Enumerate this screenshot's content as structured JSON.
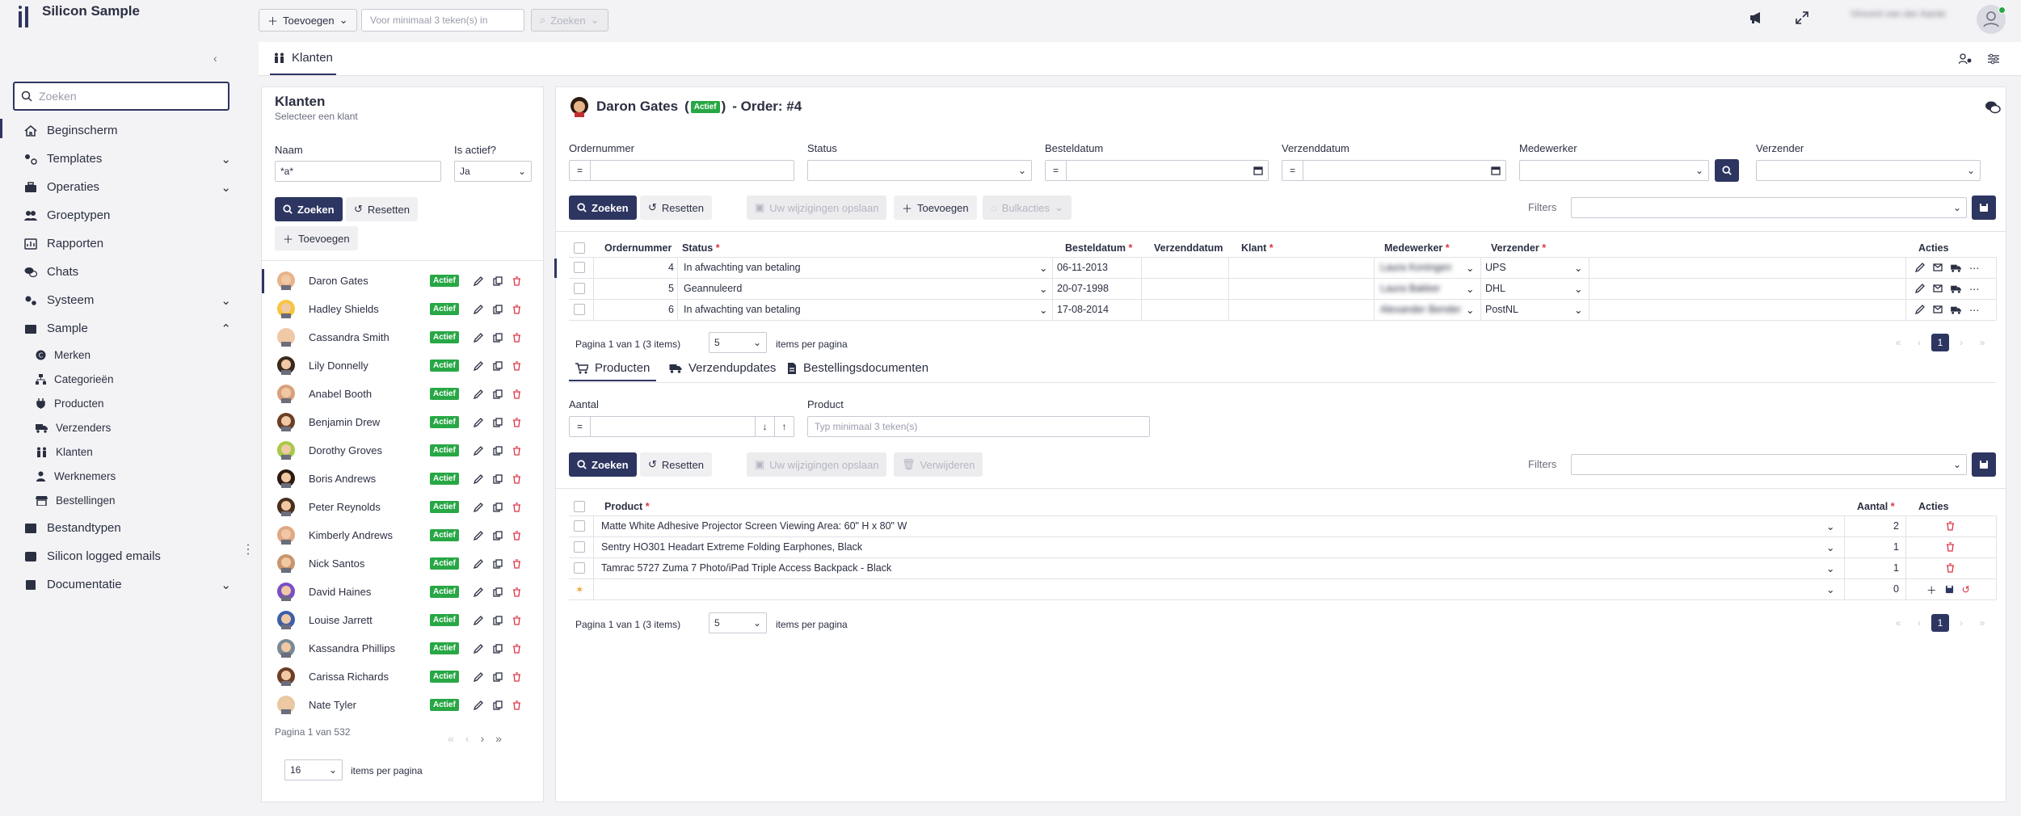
{
  "app": {
    "title": "Silicon Sample"
  },
  "topbar": {
    "add_label": "Toevoegen",
    "search_placeholder": "Voor minimaal 3 teken(s) in",
    "search_button": "Zoeken",
    "user_name": "Vincent van der Aarde"
  },
  "sidebar": {
    "search_placeholder": "Zoeken",
    "items": [
      {
        "label": "Beginscherm",
        "icon": "home-icon"
      },
      {
        "label": "Templates",
        "icon": "templates-icon"
      },
      {
        "label": "Operaties",
        "icon": "briefcase-icon"
      },
      {
        "label": "Groeptypen",
        "icon": "users-icon"
      },
      {
        "label": "Rapporten",
        "icon": "report-icon"
      },
      {
        "label": "Chats",
        "icon": "chat-icon"
      },
      {
        "label": "Systeem",
        "icon": "gears-icon"
      },
      {
        "label": "Sample",
        "icon": "database-icon"
      }
    ],
    "sub_items": [
      {
        "label": "Merken",
        "icon": "copyright-icon"
      },
      {
        "label": "Categorieën",
        "icon": "sitemap-icon"
      },
      {
        "label": "Producten",
        "icon": "plug-icon"
      },
      {
        "label": "Verzenders",
        "icon": "truck-icon"
      },
      {
        "label": "Klanten",
        "icon": "people-icon"
      },
      {
        "label": "Werknemers",
        "icon": "user-icon"
      },
      {
        "label": "Bestellingen",
        "icon": "store-icon"
      }
    ],
    "bottom_items": [
      {
        "label": "Bestandtypen",
        "icon": "filetype-icon"
      },
      {
        "label": "Silicon logged emails",
        "icon": "email-log-icon"
      },
      {
        "label": "Documentatie",
        "icon": "book-icon"
      }
    ]
  },
  "tabbar": {
    "tab_label": "Klanten"
  },
  "customers": {
    "title": "Klanten",
    "subtitle": "Selecteer een klant",
    "name_label": "Naam",
    "name_value": "*a*",
    "active_label": "Is actief?",
    "active_value": "Ja",
    "search_btn": "Zoeken",
    "reset_btn": "Resetten",
    "add_btn": "Toevoegen",
    "badge": "Actief",
    "list": [
      "Daron Gates",
      "Hadley Shields",
      "Cassandra Smith",
      "Lily Donnelly",
      "Anabel Booth",
      "Benjamin Drew",
      "Dorothy Groves",
      "Boris Andrews",
      "Peter Reynolds",
      "Kimberly Andrews",
      "Nick Santos",
      "David Haines",
      "Louise Jarrett",
      "Kassandra Phillips",
      "Carissa Richards",
      "Nate Tyler"
    ],
    "avatar_colors": [
      "#e8b48a",
      "#f5c542",
      "#f0c8a8",
      "#3a2a1e",
      "#d9a07c",
      "#6b3f26",
      "#a8c94a",
      "#2b1a10",
      "#4a2e1e",
      "#e0a884",
      "#c8956d",
      "#7a4fc4",
      "#3d5fa8",
      "#7a8a94",
      "#6b3f26",
      "#e8c8a0"
    ],
    "page_text": "Pagina 1 van 532",
    "per_page": "16",
    "per_page_label": "items per pagina"
  },
  "order": {
    "customer": "Daron Gates",
    "badge": "Actief",
    "title_suffix": "- Order: #4",
    "paren_open": "(",
    "paren_close": ")",
    "filters": {
      "ordernummer": "Ordernummer",
      "status": "Status",
      "besteldatum": "Besteldatum",
      "verzenddatum": "Verzenddatum",
      "medewerker": "Medewerker",
      "verzender": "Verzender",
      "eq": "="
    },
    "buttons": {
      "search": "Zoeken",
      "reset": "Resetten",
      "save": "Uw wijzigingen opslaan",
      "add": "Toevoegen",
      "bulk": "Bulkacties",
      "filters": "Filters"
    },
    "columns": [
      "Ordernummer",
      "Status",
      "Besteldatum",
      "Verzenddatum",
      "Klant",
      "Medewerker",
      "Verzender",
      "Acties"
    ],
    "required_mark": "*",
    "rows": [
      {
        "nr": "4",
        "status": "In afwachting van betaling",
        "date": "06-11-2013",
        "ship": "",
        "klant": "",
        "emp": "Laura Koningen",
        "carrier": "UPS"
      },
      {
        "nr": "5",
        "status": "Geannuleerd",
        "date": "20-07-1998",
        "ship": "",
        "klant": "",
        "emp": "Laura Bakker",
        "carrier": "DHL"
      },
      {
        "nr": "6",
        "status": "In afwachting van betaling",
        "date": "17-08-2014",
        "ship": "",
        "klant": "",
        "emp": "Alexander Bender",
        "carrier": "PostNL"
      }
    ],
    "page_text": "Pagina 1 van 1 (3 items)",
    "per_page": "5",
    "per_page_label": "items per pagina",
    "current_page": "1"
  },
  "subtabs": [
    {
      "label": "Producten",
      "icon": "cart-icon"
    },
    {
      "label": "Verzendupdates",
      "icon": "truck-icon"
    },
    {
      "label": "Bestellingsdocumenten",
      "icon": "document-icon"
    }
  ],
  "products": {
    "aantal_label": "Aantal",
    "product_label": "Product",
    "product_placeholder": "Typ minimaal 3 teken(s)",
    "eq": "=",
    "buttons": {
      "search": "Zoeken",
      "reset": "Resetten",
      "save": "Uw wijzigingen opslaan",
      "delete": "Verwijderen",
      "filters": "Filters"
    },
    "columns": [
      "Product",
      "Aantal",
      "Acties"
    ],
    "rows": [
      {
        "name": "Matte White Adhesive Projector Screen Viewing Area: 60\" H x 80\" W",
        "qty": "2"
      },
      {
        "name": "Sentry HO301 Headart Extreme Folding Earphones, Black",
        "qty": "1"
      },
      {
        "name": "Tamrac 5727 Zuma 7 Photo/iPad Triple Access Backpack - Black",
        "qty": "1"
      }
    ],
    "new_qty": "0",
    "page_text": "Pagina 1 van 1 (3 items)",
    "per_page": "5",
    "per_page_label": "items per pagina",
    "current_page": "1"
  },
  "colors": {
    "accent": "#2d3561",
    "badge": "#28a745",
    "delete": "#dc3545"
  }
}
